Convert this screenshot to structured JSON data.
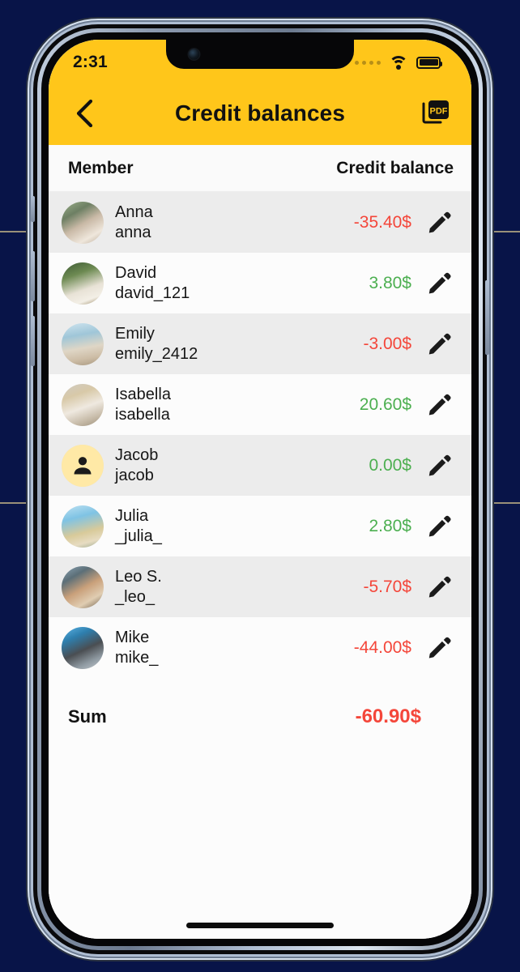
{
  "background": {
    "color": "#081448"
  },
  "status_bar": {
    "time": "2:31",
    "signal_icon": "signal-dots-icon",
    "wifi_icon": "wifi-icon",
    "battery_icon": "battery-full-icon"
  },
  "nav": {
    "back_icon": "chevron-left-icon",
    "title": "Credit balances",
    "pdf_icon": "pdf-export-icon",
    "pdf_label": "PDF",
    "bar_color": "#FFC61A"
  },
  "table": {
    "header": {
      "member": "Member",
      "balance": "Credit balance"
    },
    "edit_icon": "pencil-edit-icon",
    "rows": [
      {
        "name": "Anna",
        "username": "anna",
        "amount": "-35.40$",
        "sign": "neg",
        "avatar": "photo"
      },
      {
        "name": "David",
        "username": "david_121",
        "amount": "3.80$",
        "sign": "pos",
        "avatar": "photo"
      },
      {
        "name": "Emily",
        "username": "emily_2412",
        "amount": "-3.00$",
        "sign": "neg",
        "avatar": "photo"
      },
      {
        "name": "Isabella",
        "username": "isabella",
        "amount": "20.60$",
        "sign": "pos",
        "avatar": "photo"
      },
      {
        "name": "Jacob",
        "username": "jacob",
        "amount": "0.00$",
        "sign": "pos",
        "avatar": "placeholder"
      },
      {
        "name": "Julia",
        "username": "_julia_",
        "amount": "2.80$",
        "sign": "pos",
        "avatar": "photo"
      },
      {
        "name": "Leo S.",
        "username": "_leo_",
        "amount": "-5.70$",
        "sign": "neg",
        "avatar": "photo"
      },
      {
        "name": "Mike",
        "username": "mike_",
        "amount": "-44.00$",
        "sign": "neg",
        "avatar": "photo"
      }
    ],
    "sum": {
      "label": "Sum",
      "value": "-60.90$",
      "sign": "neg"
    }
  },
  "colors": {
    "accent": "#FFC61A",
    "negative": "#f4463a",
    "positive": "#4caf50",
    "row_alt": "#ececec",
    "row_base": "#fcfcfc"
  }
}
